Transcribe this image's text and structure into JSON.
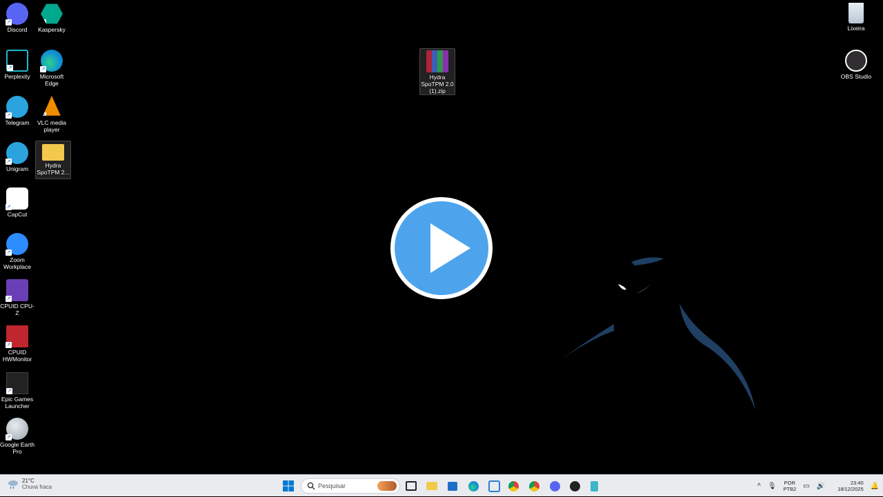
{
  "desktop_icons_left": [
    {
      "label": "Discord",
      "icon": "discord-icon",
      "color": "#5865f2"
    },
    {
      "label": "Kaspersky",
      "icon": "kaspersky-icon",
      "color": "#00a88e"
    },
    {
      "label": "Perplexity",
      "icon": "perplexity-icon",
      "color": "#1fb8cd"
    },
    {
      "label": "Microsoft Edge",
      "icon": "edge-icon",
      "color": "#0f8fd6"
    },
    {
      "label": "Telegram",
      "icon": "telegram-icon",
      "color": "#2aa3df"
    },
    {
      "label": "VLC media player",
      "icon": "vlc-icon",
      "color": "#f08c00"
    },
    {
      "label": "Unigram",
      "icon": "unigram-icon",
      "color": "#2aa3df"
    },
    {
      "label": "Hydra SpoTPM 2...",
      "icon": "folder-icon",
      "color": "#f2c94c"
    },
    {
      "label": "CapCut",
      "icon": "capcut-icon",
      "color": "#ffffff"
    },
    {
      "label": "Zoom Workplace",
      "icon": "zoom-icon",
      "color": "#2d8cff"
    },
    {
      "label": "CPUID CPU-Z",
      "icon": "cpuz-icon",
      "color": "#6a3fb5"
    },
    {
      "label": "CPUID HWMonitor",
      "icon": "hwmonitor-icon",
      "color": "#c0262d"
    },
    {
      "label": "Epic Games Launcher",
      "icon": "epic-games-icon",
      "color": "#222222"
    },
    {
      "label": "Google Earth Pro",
      "icon": "google-earth-icon",
      "color": "#9aa4ae"
    }
  ],
  "desktop_icons_right": [
    {
      "label": "Lixeira",
      "icon": "recycle-bin-icon"
    },
    {
      "label": "OBS Studio",
      "icon": "obs-icon"
    }
  ],
  "center_file": {
    "label": "Hydra SpoTPM 2.0 (1).zip",
    "icon": "winrar-archive-icon"
  },
  "video": {
    "icon": "play-button-icon",
    "color": "#4ea4ec"
  },
  "taskbar": {
    "weather_temp": "21°C",
    "weather_desc": "Chuva fraca",
    "search_placeholder": "Pesquisar",
    "apps": [
      "windows-start-icon",
      "search-icon",
      "task-view-icon",
      "file-explorer-icon",
      "store-icon",
      "edge-icon",
      "snipping-icon",
      "chrome-icon",
      "chrome-icon",
      "discord-icon",
      "app-icon",
      "notepad-icon"
    ],
    "lang_top": "POR",
    "lang_bottom": "PTB2",
    "time": "23:40",
    "date": "18/12/2025"
  }
}
